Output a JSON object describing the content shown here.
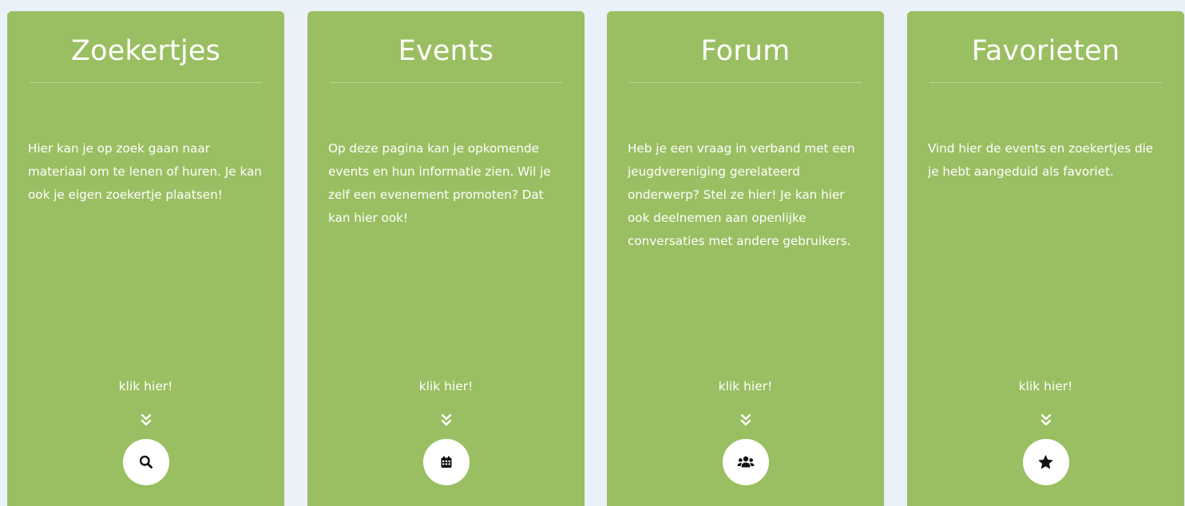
{
  "cards": [
    {
      "title": "Zoekertjes",
      "text": "Hier kan je op zoek gaan naar materiaal om te lenen of huren. Je kan ook je eigen zoekertje plaatsen!",
      "link": "klik hier!",
      "icon": "search-icon"
    },
    {
      "title": "Events",
      "text": "Op deze pagina kan je opkomende events en hun informatie zien. Wil je zelf een evenement promoten? Dat kan hier ook!",
      "link": "klik hier!",
      "icon": "calendar-icon"
    },
    {
      "title": "Forum",
      "text": "Heb je een vraag in verband met een jeugdvereniging gerelateerd onderwerp? Stel ze hier! Je kan hier ook deelnemen aan openlijke conversaties met andere gebruikers.",
      "link": "klik hier!",
      "icon": "users-icon"
    },
    {
      "title": "Favorieten",
      "text": "Vind hier de events en zoekertjes die je hebt aangeduid als favoriet.",
      "link": "klik hier!",
      "icon": "star-icon"
    }
  ],
  "colors": {
    "background": "#eaf1f9",
    "card": "#9abf62",
    "text": "#ffffff",
    "icon": "#111111"
  }
}
